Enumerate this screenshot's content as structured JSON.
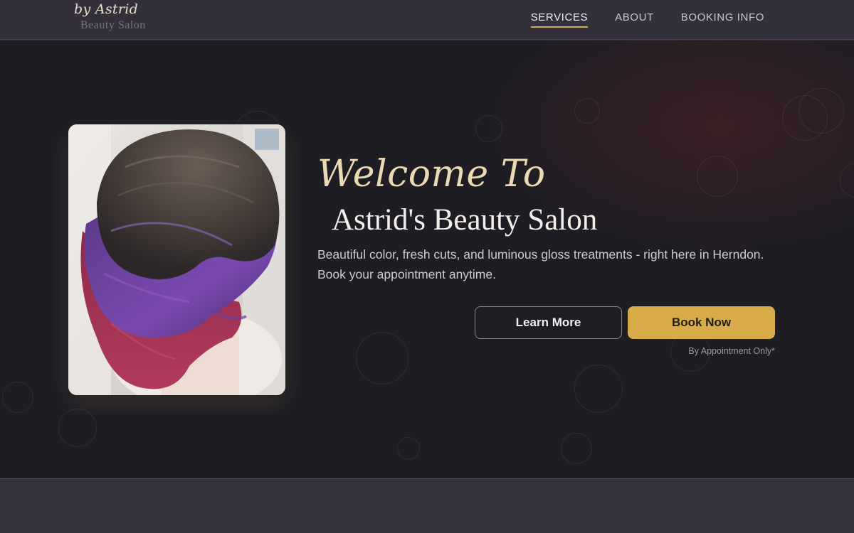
{
  "header": {
    "logo_script": "by Astrid",
    "logo_sub": "Beauty Salon",
    "nav": [
      {
        "label": "SERVICES",
        "active": true
      },
      {
        "label": "ABOUT",
        "active": false
      },
      {
        "label": "BOOKING INFO",
        "active": false
      }
    ]
  },
  "hero": {
    "welcome": "Welcome To",
    "title": "Astrid's Beauty Salon",
    "tagline_line1": "Beautiful color, fresh cuts, and luminous gloss treatments - right here in Herndon.",
    "tagline_line2": "Book your appointment anytime.",
    "learn_more_label": "Learn More",
    "book_now_label": "Book Now",
    "note": "By Appointment Only*"
  },
  "colors": {
    "header_bg": "#33303c",
    "hero_bg": "#1e1d23",
    "accent_gold": "#d8ac48",
    "welcome_text": "#ecd9b4",
    "band_bg": "#34313c"
  }
}
